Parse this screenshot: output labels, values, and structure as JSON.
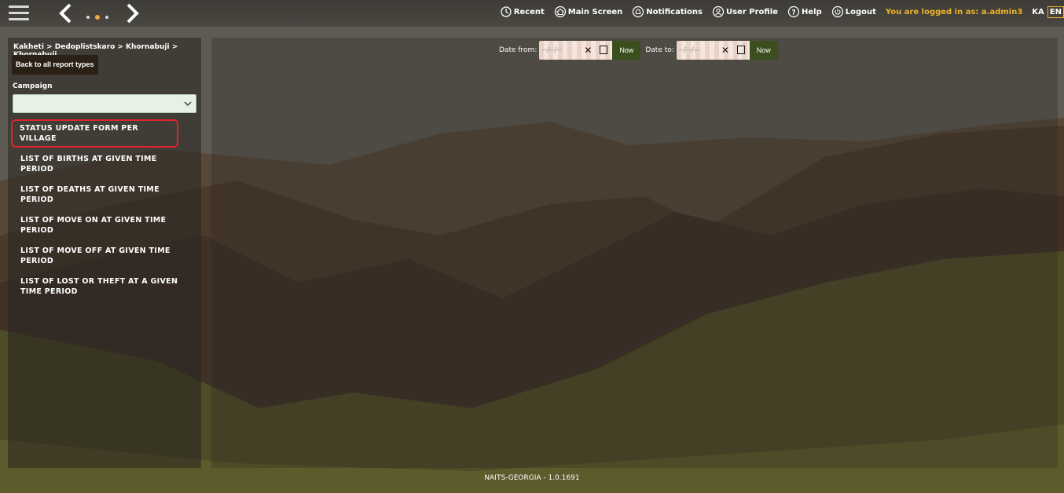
{
  "topbar": {
    "menu": [
      {
        "label": "Recent",
        "icon": "recent-icon"
      },
      {
        "label": "Main Screen",
        "icon": "home-icon"
      },
      {
        "label": "Notifications",
        "icon": "bell-icon"
      },
      {
        "label": "User Profile",
        "icon": "user-icon"
      },
      {
        "label": "Help",
        "icon": "help-icon"
      },
      {
        "label": "Logout",
        "icon": "power-icon"
      }
    ],
    "logged_in": "You are logged in as: a.admin3",
    "lang_ka": "KA",
    "lang_en": "EN"
  },
  "left": {
    "breadcrumb": "Kakheti > Dedoplistskaro > Khornabuji > Khornabuji",
    "back_button": "Back to all report types",
    "campaign_label": "Campaign",
    "campaign_value": "",
    "reports": [
      "STATUS UPDATE FORM PER VILLAGE",
      "LIST OF BIRTHS AT GIVEN TIME PERIOD",
      "LIST OF DEATHS AT GIVEN TIME PERIOD",
      "LIST OF MOVE ON AT GIVEN TIME PERIOD",
      "LIST OF MOVE OFF AT GIVEN TIME PERIOD",
      "LIST OF LOST OR THEFT AT A GIVEN TIME PERIOD"
    ]
  },
  "dates": {
    "from_label": "Date from:",
    "to_label": "Date to:",
    "placeholder": "--/--/--",
    "now_label": "Now"
  },
  "footer": "NAITS-GEORGIA - 1.0.1691",
  "colors": {
    "accent": "#f0b32a",
    "highlight": "#e3232b",
    "now": "#3a4f1d"
  }
}
